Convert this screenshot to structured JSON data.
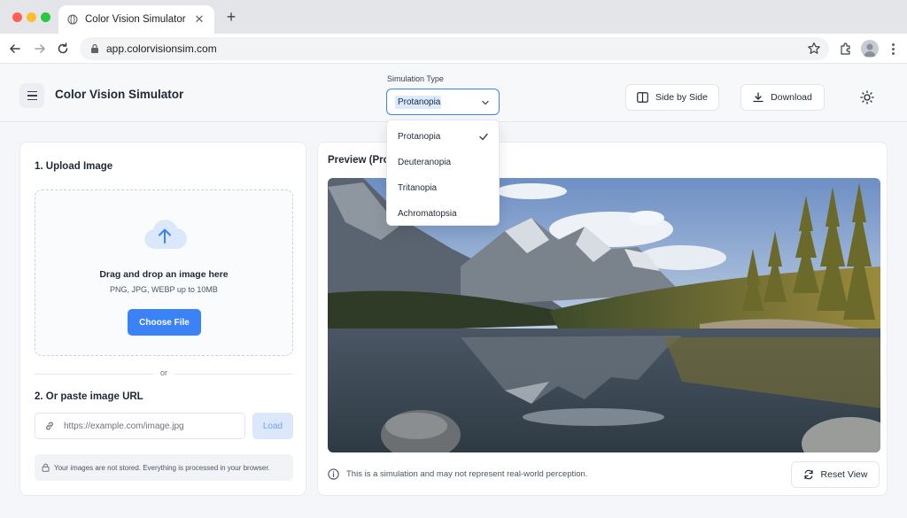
{
  "browser": {
    "tab_title": "Color Vision Simulator",
    "url": "app.colorvisionsim.com",
    "icons": [
      "back-icon",
      "forward-icon",
      "reload-icon",
      "lock-icon",
      "star-icon",
      "extensions-icon",
      "profile-icon",
      "kebab-menu-icon",
      "close-icon",
      "plus-icon"
    ]
  },
  "header": {
    "title": "Color Vision Simulator",
    "sim_type_label": "Simulation Type",
    "sim_type_value": "Protanopia",
    "side_by_side_label": "Side by Side",
    "download_label": "Download"
  },
  "dropdown": {
    "options": [
      {
        "label": "Protanopia",
        "selected": true
      },
      {
        "label": "Deuteranopia",
        "selected": false
      },
      {
        "label": "Tritanopia",
        "selected": false
      },
      {
        "label": "Achromatopsia",
        "selected": false
      }
    ]
  },
  "upload": {
    "title": "1. Upload Image",
    "drop_text": "Drag and drop an image here",
    "formats_text": "PNG, JPG, WEBP up to 10MB",
    "choose_label": "Choose File",
    "or_text": "or",
    "url_title": "2. Or paste image URL",
    "url_placeholder": "https://example.com/image.jpg",
    "load_label": "Load",
    "privacy_text": "Your images are not stored. Everything is processed in your browser."
  },
  "preview": {
    "title": "Preview (Protanopia)",
    "disclaimer": "This is a simulation and may not represent real-world perception.",
    "reset_label": "Reset View"
  },
  "colors": {
    "accent": "#3b82f6",
    "accent_light": "#dbeafe",
    "page_bg": "#f4f6f9"
  }
}
